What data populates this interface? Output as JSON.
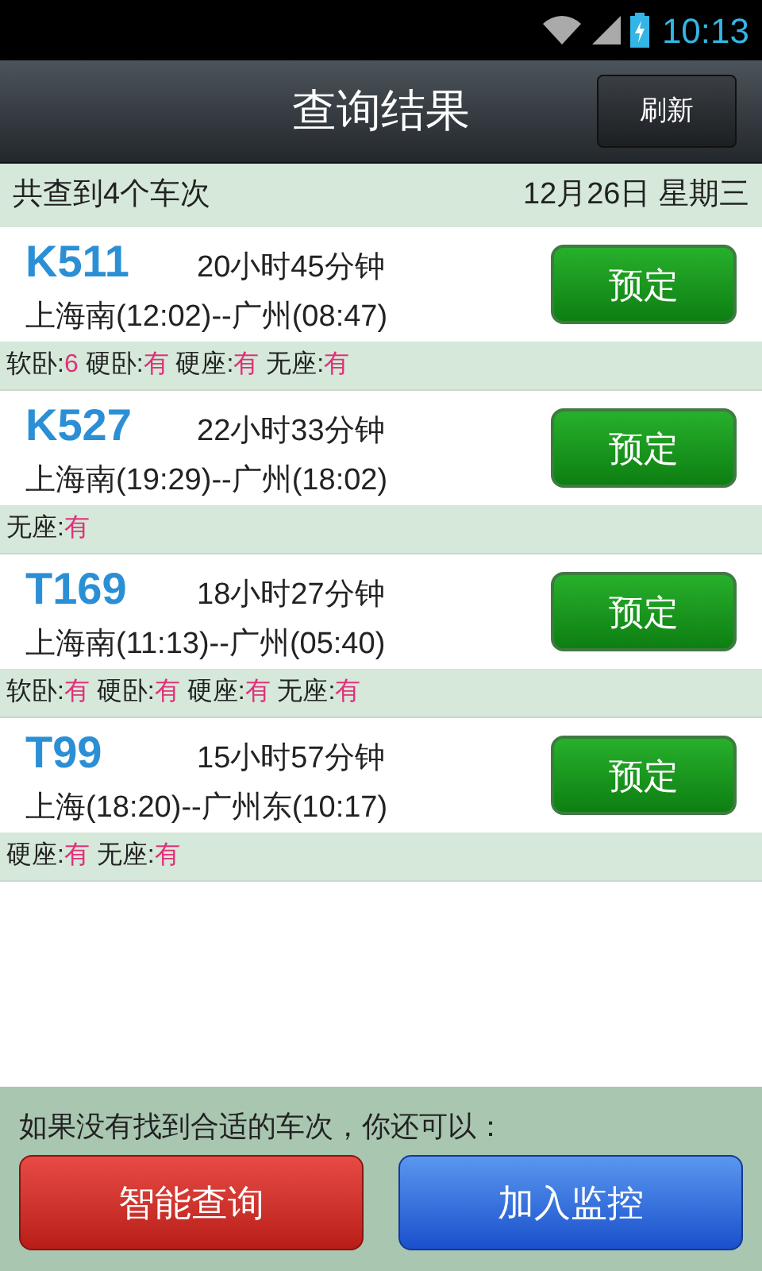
{
  "status_bar": {
    "time": "10:13"
  },
  "header": {
    "title": "查询结果",
    "refresh_button": "刷新"
  },
  "summary": {
    "count": "共查到4个车次",
    "date": "12月26日 星期三"
  },
  "trains": [
    {
      "number": "K511",
      "duration": "20小时45分钟",
      "route": "上海南(12:02)--广州(08:47)",
      "book_button": "预定",
      "seats": [
        {
          "label": "软卧:",
          "value": "6"
        },
        {
          "label": "硬卧:",
          "value": "有"
        },
        {
          "label": "硬座:",
          "value": "有"
        },
        {
          "label": "无座:",
          "value": "有"
        }
      ]
    },
    {
      "number": "K527",
      "duration": "22小时33分钟",
      "route": "上海南(19:29)--广州(18:02)",
      "book_button": "预定",
      "seats": [
        {
          "label": "无座:",
          "value": "有"
        }
      ]
    },
    {
      "number": "T169",
      "duration": "18小时27分钟",
      "route": "上海南(11:13)--广州(05:40)",
      "book_button": "预定",
      "seats": [
        {
          "label": "软卧:",
          "value": "有"
        },
        {
          "label": "硬卧:",
          "value": "有"
        },
        {
          "label": "硬座:",
          "value": "有"
        },
        {
          "label": "无座:",
          "value": "有"
        }
      ]
    },
    {
      "number": "T99",
      "duration": "15小时57分钟",
      "route": "上海(18:20)--广州东(10:17)",
      "book_button": "预定",
      "seats": [
        {
          "label": "硬座:",
          "value": "有"
        },
        {
          "label": "无座:",
          "value": "有"
        }
      ]
    }
  ],
  "footer": {
    "hint": "如果没有找到合适的车次，你还可以：",
    "buttons": [
      {
        "label": "智能查询",
        "kind": "red"
      },
      {
        "label": "加入监控",
        "kind": "blue"
      }
    ]
  }
}
